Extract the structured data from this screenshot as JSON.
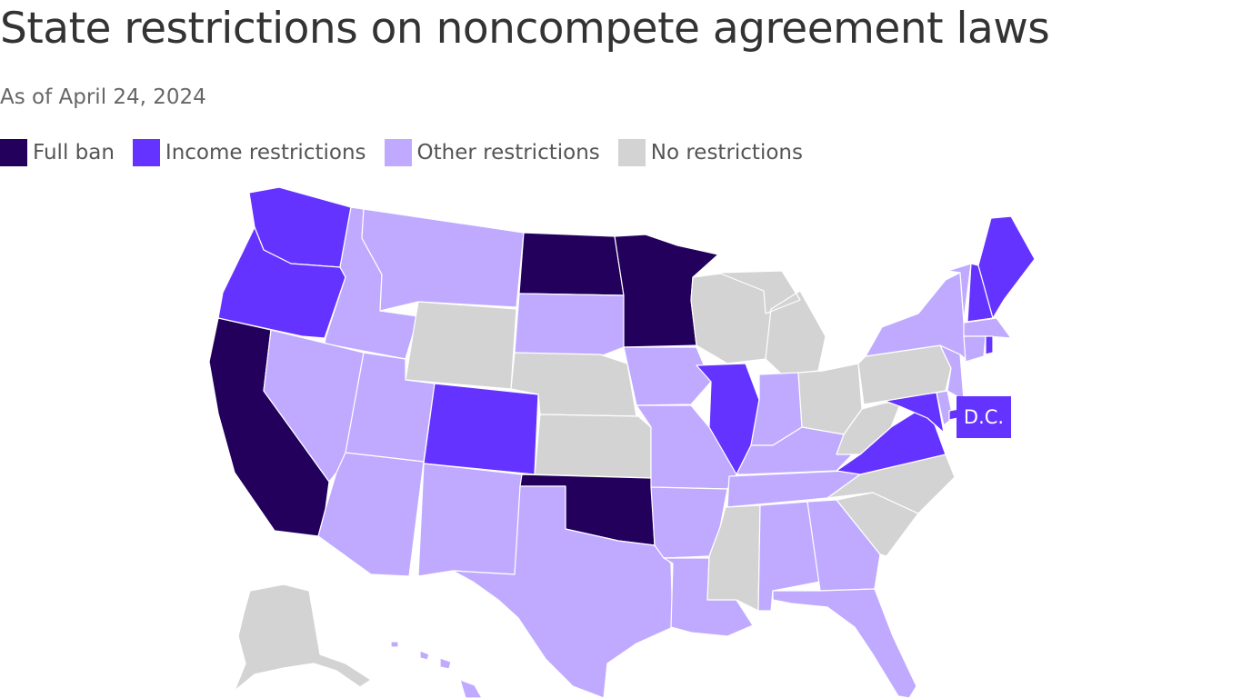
{
  "title": "State restrictions on noncompete agreement laws",
  "subtitle": "As of April 24, 2024",
  "legend": [
    {
      "key": "full",
      "label": "Full ban",
      "color": "#22005c"
    },
    {
      "key": "income",
      "label": "Income restrictions",
      "color": "#6533ff"
    },
    {
      "key": "other",
      "label": "Other restrictions",
      "color": "#bfaaff"
    },
    {
      "key": "none",
      "label": "No restrictions",
      "color": "#d3d3d3"
    }
  ],
  "colors": {
    "full": "#22005c",
    "income": "#6533ff",
    "other": "#bfaaff",
    "none": "#d3d3d3"
  },
  "callout": {
    "label": "D.C."
  },
  "states": {
    "WA": "income",
    "OR": "income",
    "CA": "full",
    "ID": "other",
    "NV": "other",
    "MT": "other",
    "WY": "none",
    "UT": "other",
    "AZ": "other",
    "CO": "income",
    "NM": "other",
    "ND": "full",
    "SD": "other",
    "NE": "none",
    "KS": "none",
    "OK": "full",
    "TX": "other",
    "MN": "full",
    "IA": "other",
    "MO": "other",
    "AR": "other",
    "LA": "other",
    "WI": "none",
    "IL": "income",
    "MI": "none",
    "IN": "other",
    "OH": "none",
    "KY": "other",
    "TN": "other",
    "MS": "none",
    "AL": "other",
    "GA": "other",
    "FL": "other",
    "SC": "none",
    "NC": "none",
    "VA": "income",
    "WV": "none",
    "PA": "none",
    "NY": "other",
    "VT": "other",
    "NH": "income",
    "ME": "income",
    "MA": "other",
    "RI": "income",
    "CT": "other",
    "NJ": "other",
    "DE": "other",
    "MD": "income",
    "DC": "income",
    "AK": "none",
    "HI": "other"
  }
}
